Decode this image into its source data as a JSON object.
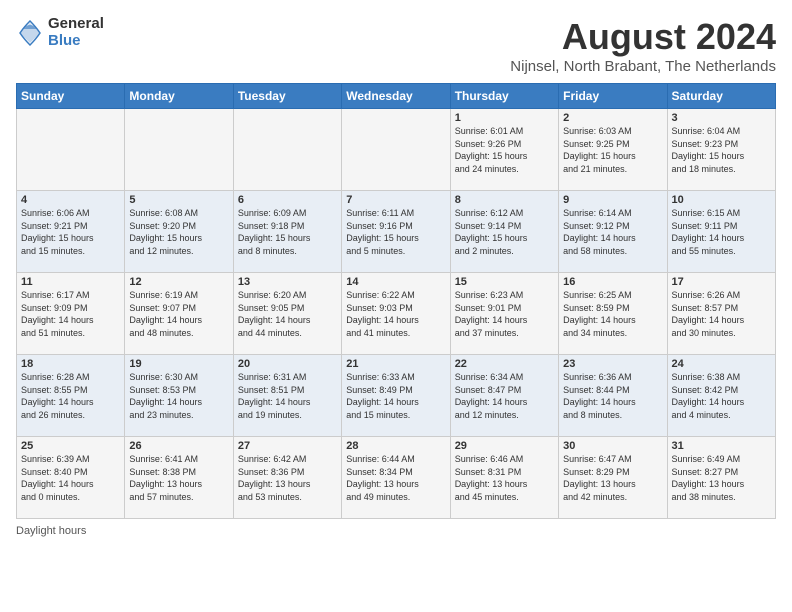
{
  "header": {
    "logo": {
      "general": "General",
      "blue": "Blue"
    },
    "title": "August 2024",
    "subtitle": "Nijnsel, North Brabant, The Netherlands"
  },
  "calendar": {
    "days_of_week": [
      "Sunday",
      "Monday",
      "Tuesday",
      "Wednesday",
      "Thursday",
      "Friday",
      "Saturday"
    ],
    "weeks": [
      [
        {
          "day": "",
          "detail": ""
        },
        {
          "day": "",
          "detail": ""
        },
        {
          "day": "",
          "detail": ""
        },
        {
          "day": "",
          "detail": ""
        },
        {
          "day": "1",
          "detail": "Sunrise: 6:01 AM\nSunset: 9:26 PM\nDaylight: 15 hours\nand 24 minutes."
        },
        {
          "day": "2",
          "detail": "Sunrise: 6:03 AM\nSunset: 9:25 PM\nDaylight: 15 hours\nand 21 minutes."
        },
        {
          "day": "3",
          "detail": "Sunrise: 6:04 AM\nSunset: 9:23 PM\nDaylight: 15 hours\nand 18 minutes."
        }
      ],
      [
        {
          "day": "4",
          "detail": "Sunrise: 6:06 AM\nSunset: 9:21 PM\nDaylight: 15 hours\nand 15 minutes."
        },
        {
          "day": "5",
          "detail": "Sunrise: 6:08 AM\nSunset: 9:20 PM\nDaylight: 15 hours\nand 12 minutes."
        },
        {
          "day": "6",
          "detail": "Sunrise: 6:09 AM\nSunset: 9:18 PM\nDaylight: 15 hours\nand 8 minutes."
        },
        {
          "day": "7",
          "detail": "Sunrise: 6:11 AM\nSunset: 9:16 PM\nDaylight: 15 hours\nand 5 minutes."
        },
        {
          "day": "8",
          "detail": "Sunrise: 6:12 AM\nSunset: 9:14 PM\nDaylight: 15 hours\nand 2 minutes."
        },
        {
          "day": "9",
          "detail": "Sunrise: 6:14 AM\nSunset: 9:12 PM\nDaylight: 14 hours\nand 58 minutes."
        },
        {
          "day": "10",
          "detail": "Sunrise: 6:15 AM\nSunset: 9:11 PM\nDaylight: 14 hours\nand 55 minutes."
        }
      ],
      [
        {
          "day": "11",
          "detail": "Sunrise: 6:17 AM\nSunset: 9:09 PM\nDaylight: 14 hours\nand 51 minutes."
        },
        {
          "day": "12",
          "detail": "Sunrise: 6:19 AM\nSunset: 9:07 PM\nDaylight: 14 hours\nand 48 minutes."
        },
        {
          "day": "13",
          "detail": "Sunrise: 6:20 AM\nSunset: 9:05 PM\nDaylight: 14 hours\nand 44 minutes."
        },
        {
          "day": "14",
          "detail": "Sunrise: 6:22 AM\nSunset: 9:03 PM\nDaylight: 14 hours\nand 41 minutes."
        },
        {
          "day": "15",
          "detail": "Sunrise: 6:23 AM\nSunset: 9:01 PM\nDaylight: 14 hours\nand 37 minutes."
        },
        {
          "day": "16",
          "detail": "Sunrise: 6:25 AM\nSunset: 8:59 PM\nDaylight: 14 hours\nand 34 minutes."
        },
        {
          "day": "17",
          "detail": "Sunrise: 6:26 AM\nSunset: 8:57 PM\nDaylight: 14 hours\nand 30 minutes."
        }
      ],
      [
        {
          "day": "18",
          "detail": "Sunrise: 6:28 AM\nSunset: 8:55 PM\nDaylight: 14 hours\nand 26 minutes."
        },
        {
          "day": "19",
          "detail": "Sunrise: 6:30 AM\nSunset: 8:53 PM\nDaylight: 14 hours\nand 23 minutes."
        },
        {
          "day": "20",
          "detail": "Sunrise: 6:31 AM\nSunset: 8:51 PM\nDaylight: 14 hours\nand 19 minutes."
        },
        {
          "day": "21",
          "detail": "Sunrise: 6:33 AM\nSunset: 8:49 PM\nDaylight: 14 hours\nand 15 minutes."
        },
        {
          "day": "22",
          "detail": "Sunrise: 6:34 AM\nSunset: 8:47 PM\nDaylight: 14 hours\nand 12 minutes."
        },
        {
          "day": "23",
          "detail": "Sunrise: 6:36 AM\nSunset: 8:44 PM\nDaylight: 14 hours\nand 8 minutes."
        },
        {
          "day": "24",
          "detail": "Sunrise: 6:38 AM\nSunset: 8:42 PM\nDaylight: 14 hours\nand 4 minutes."
        }
      ],
      [
        {
          "day": "25",
          "detail": "Sunrise: 6:39 AM\nSunset: 8:40 PM\nDaylight: 14 hours\nand 0 minutes."
        },
        {
          "day": "26",
          "detail": "Sunrise: 6:41 AM\nSunset: 8:38 PM\nDaylight: 13 hours\nand 57 minutes."
        },
        {
          "day": "27",
          "detail": "Sunrise: 6:42 AM\nSunset: 8:36 PM\nDaylight: 13 hours\nand 53 minutes."
        },
        {
          "day": "28",
          "detail": "Sunrise: 6:44 AM\nSunset: 8:34 PM\nDaylight: 13 hours\nand 49 minutes."
        },
        {
          "day": "29",
          "detail": "Sunrise: 6:46 AM\nSunset: 8:31 PM\nDaylight: 13 hours\nand 45 minutes."
        },
        {
          "day": "30",
          "detail": "Sunrise: 6:47 AM\nSunset: 8:29 PM\nDaylight: 13 hours\nand 42 minutes."
        },
        {
          "day": "31",
          "detail": "Sunrise: 6:49 AM\nSunset: 8:27 PM\nDaylight: 13 hours\nand 38 minutes."
        }
      ]
    ]
  },
  "footer": {
    "text": "Daylight hours"
  }
}
